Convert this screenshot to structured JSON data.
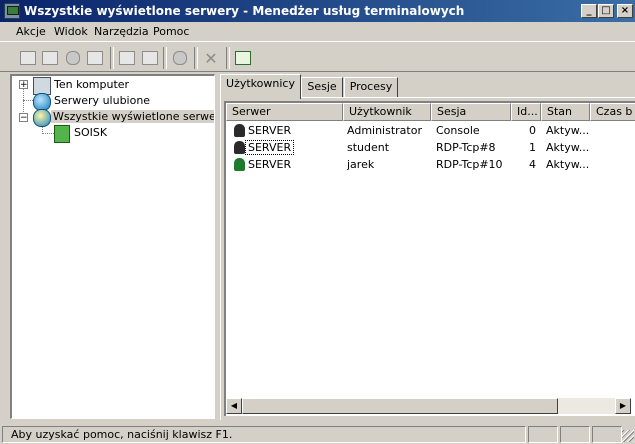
{
  "window": {
    "title": "Wszystkie wyświetlone serwery - Menedżer usług terminalowych",
    "buttons": {
      "minimize": "_",
      "maximize": "□",
      "close": "×"
    }
  },
  "menu": [
    {
      "label": "Akcje"
    },
    {
      "label": "Widok"
    },
    {
      "label": "Narzędzia"
    },
    {
      "label": "Pomoc"
    }
  ],
  "toolbar": {
    "icons": [
      "connect-icon",
      "disconnect-icon",
      "send-message-icon",
      "remote-control-icon",
      "reset-icon",
      "status-icon",
      "logoff-icon",
      "end-process-icon",
      "refresh-icon"
    ]
  },
  "tree": {
    "items": [
      {
        "label": "Ten komputer",
        "expander": "+"
      },
      {
        "label": "Serwery ulubione"
      },
      {
        "label": "Wszystkie wyświetlone serwery",
        "expander": "−",
        "selected": true
      },
      {
        "label": "SOISK"
      }
    ]
  },
  "tabs": [
    {
      "label": "Użytkownicy",
      "active": true
    },
    {
      "label": "Sesje"
    },
    {
      "label": "Procesy"
    }
  ],
  "table": {
    "columns": [
      "Serwer",
      "Użytkownik",
      "Sesja",
      "Id...",
      "Stan",
      "Czas b"
    ],
    "rows": [
      {
        "server": "SERVER",
        "user": "Administrator",
        "session": "Console",
        "id": "0",
        "state": "Aktyw...",
        "idle": ""
      },
      {
        "server": "SERVER",
        "user": "student",
        "session": "RDP-Tcp#8",
        "id": "1",
        "state": "Aktyw...",
        "idle": ""
      },
      {
        "server": "SERVER",
        "user": "jarek",
        "session": "RDP-Tcp#10",
        "id": "4",
        "state": "Aktyw...",
        "idle": ""
      }
    ]
  },
  "status": {
    "text": "Aby uzyskać pomoc, naciśnij klawisz F1."
  }
}
